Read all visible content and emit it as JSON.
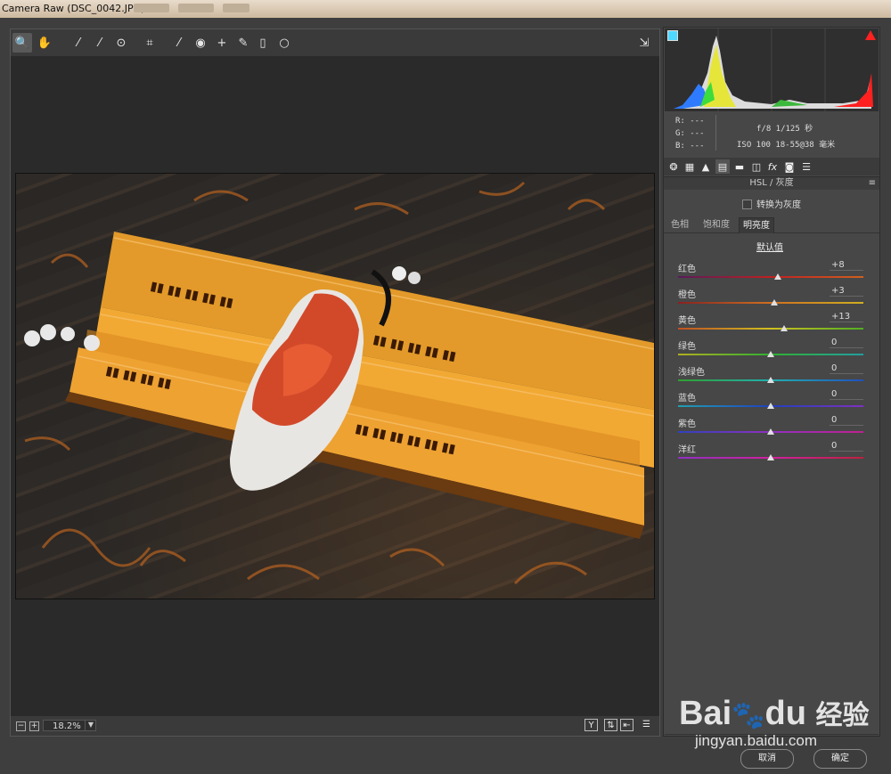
{
  "window": {
    "title": "Camera Raw (DSC_0042.JPG)"
  },
  "toolbar": {
    "tools": [
      {
        "name": "zoom-tool-icon",
        "glyph": "🔍"
      },
      {
        "name": "hand-tool-icon",
        "glyph": "✋"
      },
      {
        "name": "white-balance-tool-icon",
        "glyph": "⁄"
      },
      {
        "name": "color-sampler-tool-icon",
        "glyph": "⁄"
      },
      {
        "name": "targeted-adjustment-tool-icon",
        "glyph": "⊙"
      },
      {
        "name": "crop-tool-icon",
        "glyph": "⌗"
      },
      {
        "name": "straighten-tool-icon",
        "glyph": "⁄"
      },
      {
        "name": "red-eye-tool-icon",
        "glyph": "◉"
      },
      {
        "name": "spot-removal-tool-icon",
        "glyph": "+"
      },
      {
        "name": "adjustment-brush-icon",
        "glyph": "✎"
      },
      {
        "name": "graduated-filter-icon",
        "glyph": "▯"
      },
      {
        "name": "radial-filter-icon",
        "glyph": "○"
      }
    ],
    "open_prefs_icon": "⇲"
  },
  "bottom": {
    "zoom": "18.2%"
  },
  "histogram": {
    "clip_shadow_color": "#4fd8ff",
    "clip_highlight_color": "#ff2020"
  },
  "meta": {
    "r": "R:  ---",
    "g": "G:  ---",
    "b": "B:  ---",
    "exposure": "f/8   1/125 秒",
    "iso": "ISO 100   18-55@38 毫米"
  },
  "panel": {
    "title": "HSL / 灰度",
    "convert_gray": "转换为灰度",
    "tabs": [
      "色相",
      "饱和度",
      "明亮度"
    ],
    "active_tab": 2,
    "default_label": "默认值",
    "sliders": [
      {
        "label": "红色",
        "value": "+8",
        "pos": 0.54,
        "grad": "linear-gradient(90deg,#5a1a5a,#c02020,#d06020)"
      },
      {
        "label": "橙色",
        "value": "+3",
        "pos": 0.52,
        "grad": "linear-gradient(90deg,#8a2020,#d07020,#d0b020)"
      },
      {
        "label": "黄色",
        "value": "+13",
        "pos": 0.57,
        "grad": "linear-gradient(90deg,#c05020,#d0c020,#50b020)"
      },
      {
        "label": "绿色",
        "value": "0",
        "pos": 0.5,
        "grad": "linear-gradient(90deg,#b0b020,#30b030,#20a0a0)"
      },
      {
        "label": "浅绿色",
        "value": "0",
        "pos": 0.5,
        "grad": "linear-gradient(90deg,#30a030,#20b0b0,#2050c0)"
      },
      {
        "label": "蓝色",
        "value": "0",
        "pos": 0.5,
        "grad": "linear-gradient(90deg,#20a0b0,#2040c0,#8030c0)"
      },
      {
        "label": "紫色",
        "value": "0",
        "pos": 0.5,
        "grad": "linear-gradient(90deg,#3040c0,#9030c0,#c02090)"
      },
      {
        "label": "洋红",
        "value": "0",
        "pos": 0.5,
        "grad": "linear-gradient(90deg,#9030c0,#d020a0,#c02040)"
      }
    ]
  },
  "buttons": {
    "cancel": "取消",
    "ok": "确定"
  },
  "watermark": {
    "brand": "Bai",
    "brand2": "du",
    "cn": "经验",
    "url": "jingyan.baidu.com"
  }
}
